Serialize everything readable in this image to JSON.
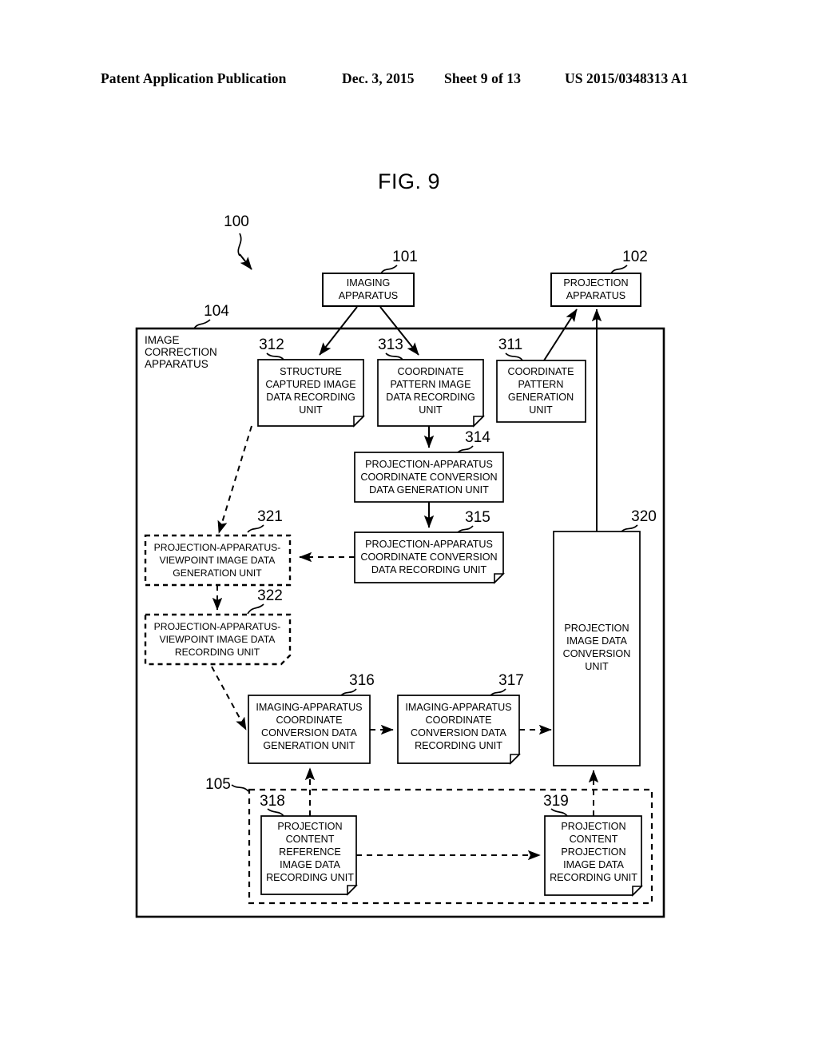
{
  "header": {
    "publication": "Patent Application Publication",
    "date": "Dec. 3, 2015",
    "sheet": "Sheet 9 of 13",
    "number": "US 2015/0348313 A1"
  },
  "figure": {
    "title": "FIG. 9"
  },
  "reference_numerals": {
    "system": "100",
    "imaging_apparatus": "101",
    "projection_apparatus": "102",
    "image_correction_apparatus": "104",
    "content_storage": "105",
    "coordinate_pattern_generation_unit": "311",
    "structure_captured_image_data_recording_unit": "312",
    "coordinate_pattern_image_data_recording_unit": "313",
    "projection_coord_conversion_data_generation_unit": "314",
    "projection_coord_conversion_data_recording_unit": "315",
    "imaging_coord_conversion_data_generation_unit": "316",
    "imaging_coord_conversion_data_recording_unit": "317",
    "projection_content_reference_image_data_recording_unit": "318",
    "projection_content_projection_image_data_recording_unit": "319",
    "projection_image_data_conversion_unit": "320",
    "projection_viewpoint_image_data_generation_unit": "321",
    "projection_viewpoint_image_data_recording_unit": "322"
  },
  "blocks": {
    "imaging_apparatus": {
      "lines": [
        "IMAGING",
        "APPARATUS"
      ]
    },
    "projection_apparatus": {
      "lines": [
        "PROJECTION",
        "APPARATUS"
      ]
    },
    "image_correction_apparatus": {
      "lines": [
        "IMAGE",
        "CORRECTION",
        "APPARATUS"
      ]
    },
    "b312": {
      "lines": [
        "STRUCTURE",
        "CAPTURED IMAGE",
        "DATA RECORDING",
        "UNIT"
      ]
    },
    "b313": {
      "lines": [
        "COORDINATE",
        "PATTERN IMAGE",
        "DATA RECORDING",
        "UNIT"
      ]
    },
    "b311": {
      "lines": [
        "COORDINATE",
        "PATTERN",
        "GENERATION",
        "UNIT"
      ]
    },
    "b314": {
      "lines": [
        "PROJECTION-APPARATUS",
        "COORDINATE CONVERSION",
        "DATA GENERATION UNIT"
      ]
    },
    "b315": {
      "lines": [
        "PROJECTION-APPARATUS",
        "COORDINATE CONVERSION",
        "DATA RECORDING UNIT"
      ]
    },
    "b321": {
      "lines": [
        "PROJECTION-APPARATUS-",
        "VIEWPOINT IMAGE DATA",
        "GENERATION UNIT"
      ]
    },
    "b322": {
      "lines": [
        "PROJECTION-APPARATUS-",
        "VIEWPOINT IMAGE DATA",
        "RECORDING UNIT"
      ]
    },
    "b316": {
      "lines": [
        "IMAGING-APPARATUS",
        "COORDINATE",
        "CONVERSION DATA",
        "GENERATION UNIT"
      ]
    },
    "b317": {
      "lines": [
        "IMAGING-APPARATUS",
        "COORDINATE",
        "CONVERSION DATA",
        "RECORDING UNIT"
      ]
    },
    "b318": {
      "lines": [
        "PROJECTION",
        "CONTENT",
        "REFERENCE",
        "IMAGE DATA",
        "RECORDING UNIT"
      ]
    },
    "b319": {
      "lines": [
        "PROJECTION",
        "CONTENT",
        "PROJECTION",
        "IMAGE DATA",
        "RECORDING UNIT"
      ]
    },
    "b320": {
      "lines": [
        "PROJECTION",
        "IMAGE DATA",
        "CONVERSION",
        "UNIT"
      ]
    }
  },
  "colors": {
    "ink": "#000000",
    "paper": "#ffffff"
  }
}
